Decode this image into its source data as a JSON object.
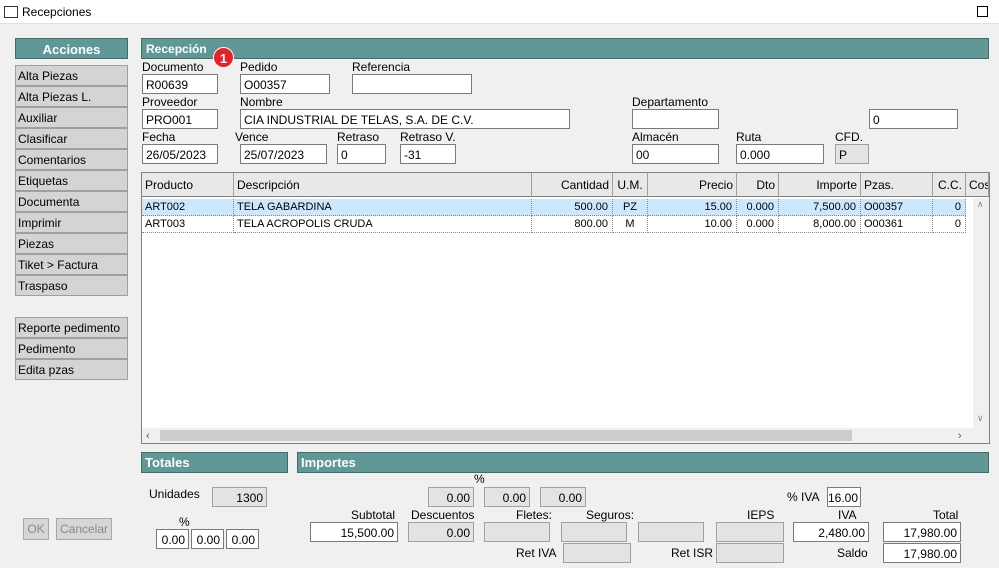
{
  "window": {
    "title": "Recepciones"
  },
  "sidebar": {
    "header": "Acciones",
    "items": [
      "Alta Piezas",
      "Alta Piezas L.",
      "Auxiliar",
      "Clasificar",
      "Comentarios",
      "Etiquetas",
      "Documenta",
      "Imprimir",
      "Piezas",
      "Tiket > Factura",
      "Traspaso"
    ],
    "items2": [
      "Reporte pedimento",
      "Pedimento",
      "Edita pzas"
    ]
  },
  "reception": {
    "header": "Recepción",
    "badge": "1",
    "documento": {
      "label": "Documento",
      "value": "R00639"
    },
    "pedido": {
      "label": "Pedido",
      "value": "O00357"
    },
    "referencia": {
      "label": "Referencia",
      "value": ""
    },
    "proveedor": {
      "label": "Proveedor",
      "value": "PRO001"
    },
    "nombre": {
      "label": "Nombre",
      "value": "CIA INDUSTRIAL DE TELAS, S.A. DE C.V."
    },
    "departamento": {
      "label": "Departamento",
      "value": "",
      "extra": "0"
    },
    "fecha": {
      "label": "Fecha",
      "value": "26/05/2023"
    },
    "vence": {
      "label": "Vence",
      "value": "25/07/2023"
    },
    "retraso": {
      "label": "Retraso",
      "value": "0"
    },
    "retraso_v": {
      "label": "Retraso V.",
      "value": "-31"
    },
    "almacen": {
      "label": "Almacén",
      "value": "00"
    },
    "ruta": {
      "label": "Ruta",
      "value": "0.000"
    },
    "cfd": {
      "label": "CFD.",
      "value": "P"
    }
  },
  "grid": {
    "columns": [
      "Producto",
      "Descripción",
      "Cantidad",
      "U.M.",
      "Precio",
      "Dto",
      "Importe",
      "Pzas.",
      "C.C.",
      "Cos"
    ],
    "rows": [
      [
        "ART002",
        "TELA GABARDINA",
        "500.00",
        "PZ",
        "15.00",
        "0.000",
        "7,500.00",
        "O00357",
        "0"
      ],
      [
        "ART003",
        "TELA ACROPOLIS CRUDA",
        "800.00",
        "M",
        "10.00",
        "0.000",
        "8,000.00",
        "O00361",
        "0"
      ]
    ]
  },
  "totales": {
    "header": "Totales",
    "unidades_label": "Unidades",
    "unidades_value": "1300",
    "pct_label": "%",
    "pct_values": [
      "0.00",
      "0.00",
      "0.00"
    ]
  },
  "importes": {
    "header": "Importes",
    "pct_label": "%",
    "pct_values": [
      "0.00",
      "0.00",
      "0.00"
    ],
    "iva_pct_label": "% IVA",
    "iva_pct_value": "16.00",
    "subtotal": {
      "label": "Subtotal",
      "value": "15,500.00"
    },
    "descuentos": {
      "label": "Descuentos",
      "value": "0.00"
    },
    "fletes": {
      "label": "Fletes:",
      "value": ""
    },
    "seguros": {
      "label": "Seguros:",
      "value": ""
    },
    "ieps": {
      "label": "IEPS",
      "value": ""
    },
    "iva": {
      "label": "IVA",
      "value": "2,480.00"
    },
    "total": {
      "label": "Total",
      "value": "17,980.00"
    },
    "ret_iva": {
      "label": "Ret IVA",
      "value": ""
    },
    "ret_isr": {
      "label": "Ret ISR",
      "value": ""
    },
    "saldo": {
      "label": "Saldo",
      "value": "17,980.00"
    }
  },
  "buttons": {
    "ok": "OK",
    "cancel": "Cancelar"
  }
}
